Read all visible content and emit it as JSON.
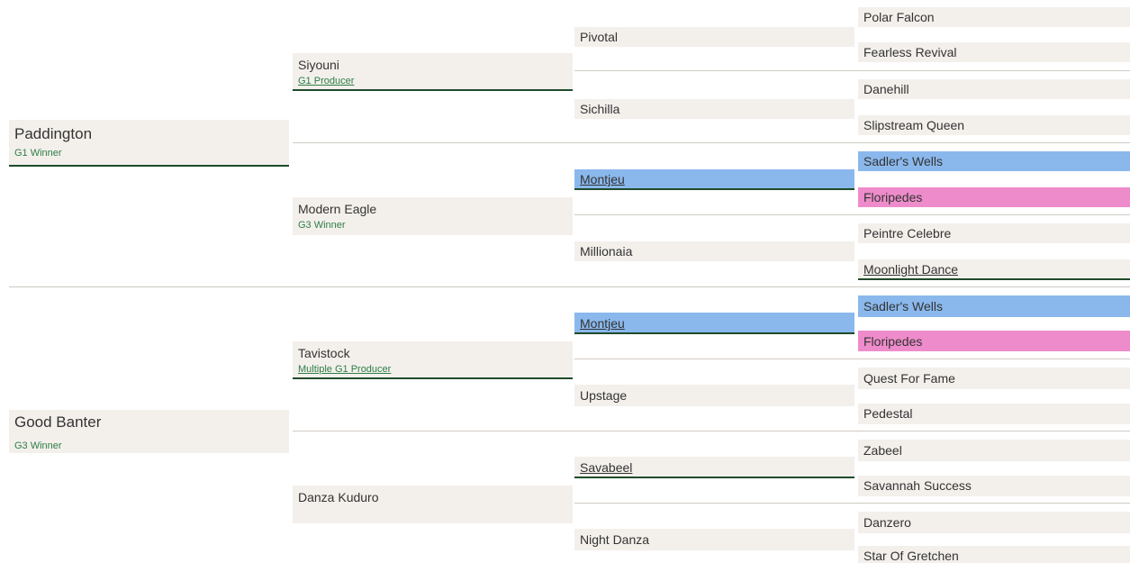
{
  "gen1": [
    {
      "name": "Paddington",
      "sub": "G1 Winner"
    },
    {
      "name": "Good Banter",
      "sub": "G3 Winner"
    }
  ],
  "gen2": [
    {
      "name": "Siyouni",
      "sub": "G1 Producer"
    },
    {
      "name": "Modern Eagle",
      "sub": "G3 Winner"
    },
    {
      "name": "Tavistock",
      "sub": "Multiple G1 Producer"
    },
    {
      "name": "Danza Kuduro"
    }
  ],
  "gen3": [
    {
      "name": "Pivotal"
    },
    {
      "name": "Sichilla"
    },
    {
      "name": "Montjeu",
      "highlight": "blue"
    },
    {
      "name": "Millionaia"
    },
    {
      "name": "Montjeu",
      "highlight": "blue"
    },
    {
      "name": "Upstage"
    },
    {
      "name": "Savabeel"
    },
    {
      "name": "Night Danza"
    }
  ],
  "gen4": [
    {
      "name": "Polar Falcon"
    },
    {
      "name": "Fearless Revival"
    },
    {
      "name": "Danehill"
    },
    {
      "name": "Slipstream Queen"
    },
    {
      "name": "Sadler's Wells",
      "highlight": "blue"
    },
    {
      "name": "Floripedes",
      "highlight": "pink"
    },
    {
      "name": "Peintre Celebre"
    },
    {
      "name": "Moonlight Dance"
    },
    {
      "name": "Sadler's Wells",
      "highlight": "blue"
    },
    {
      "name": "Floripedes",
      "highlight": "pink"
    },
    {
      "name": "Quest For Fame"
    },
    {
      "name": "Pedestal"
    },
    {
      "name": "Zabeel"
    },
    {
      "name": "Savannah Success"
    },
    {
      "name": "Danzero"
    },
    {
      "name": "Star Of Gretchen"
    }
  ],
  "colors": {
    "accent_line": "#204b2c",
    "sub_text": "#2e7d46",
    "highlight_blue": "#8ab8ec",
    "highlight_pink": "#ee8ccb",
    "box_bg": "#f3f0ec"
  }
}
